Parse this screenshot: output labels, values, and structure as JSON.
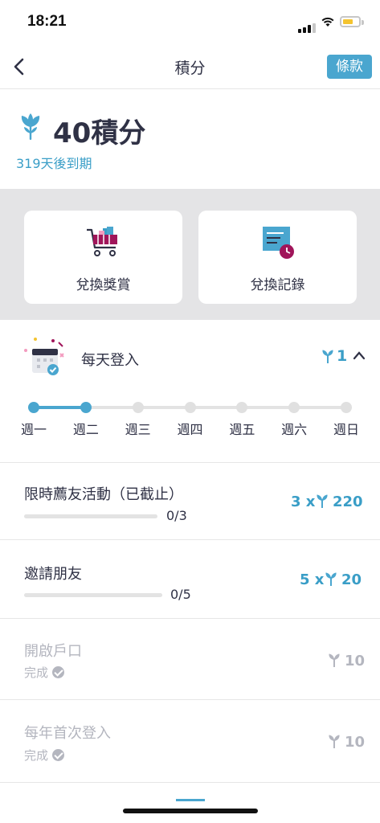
{
  "status_bar": {
    "time": "18:21"
  },
  "nav": {
    "title": "積分",
    "terms_label": "條款"
  },
  "points": {
    "value": "40積分",
    "expiry": "319天後到期"
  },
  "cards": [
    {
      "label": "兌換獎賞",
      "icon": "shopping-cart-icon"
    },
    {
      "label": "兌換記錄",
      "icon": "history-record-icon"
    }
  ],
  "daily": {
    "title": "每天登入",
    "reward": "1",
    "days": [
      "週一",
      "週二",
      "週三",
      "週四",
      "週五",
      "週六",
      "週日"
    ],
    "completed_days": 2
  },
  "tasks": [
    {
      "title": "限時薦友活動（已截止）",
      "progress": "0/3",
      "reward": "3 x",
      "points": "220",
      "done": false
    },
    {
      "title": "邀請朋友",
      "progress": "0/5",
      "reward": "5 x",
      "points": "20",
      "done": false
    },
    {
      "title": "開啟戶口",
      "status": "完成",
      "points": "10",
      "done": true
    },
    {
      "title": "每年首次登入",
      "status": "完成",
      "points": "10",
      "done": true
    }
  ],
  "colors": {
    "accent": "#4aa6cf",
    "text": "#2f3145",
    "muted": "#b4b6bf",
    "band": "#e4e4e6"
  }
}
